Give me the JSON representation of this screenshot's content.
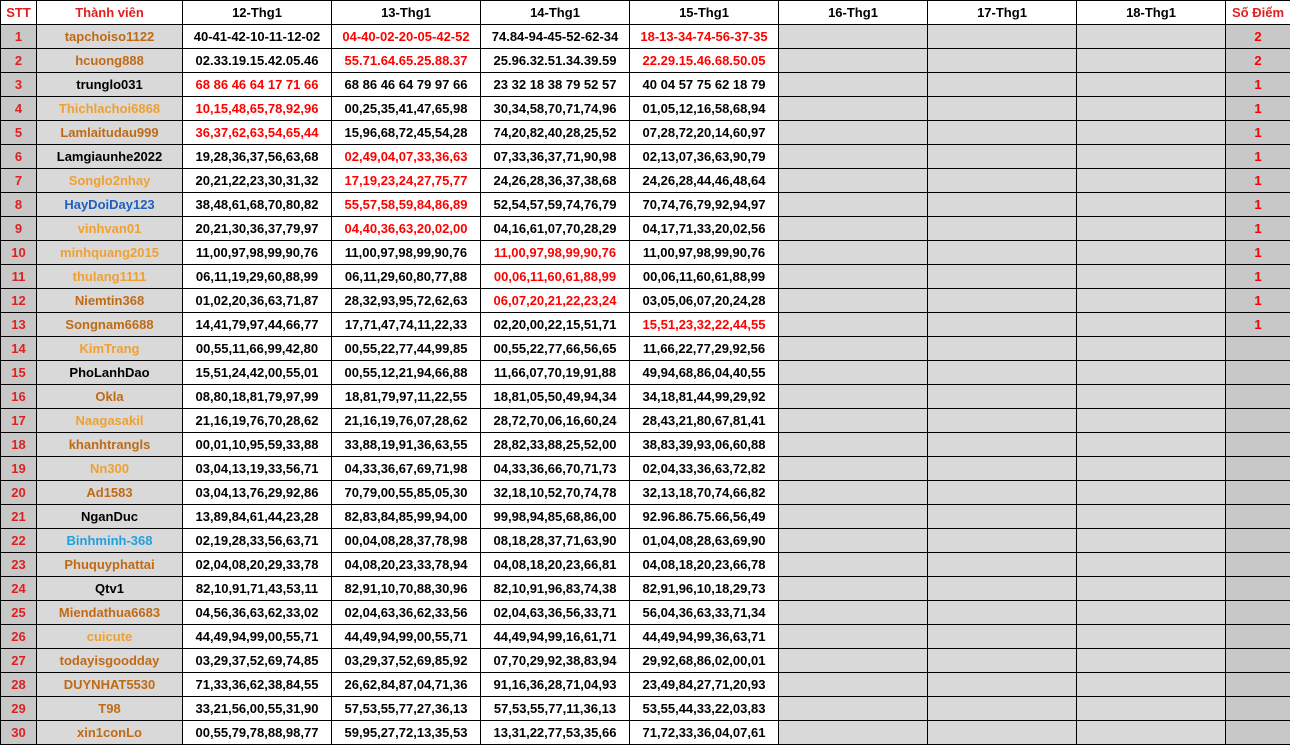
{
  "headers": {
    "stt": "STT",
    "member": "Thành viên",
    "days": [
      "12-Thg1",
      "13-Thg1",
      "14-Thg1",
      "15-Thg1",
      "16-Thg1",
      "17-Thg1",
      "18-Thg1"
    ],
    "score": "Số Điểm"
  },
  "colors": {
    "header_red": "#e02020",
    "highlight_red": "#ff0000",
    "name_orange": "#c06a14",
    "name_light_orange": "#f0a030",
    "name_blue": "#1f5fc4",
    "name_cyan": "#1fa0e0",
    "name_black": "#000000",
    "grey_fill": "#d9d9d9",
    "dark_grey_fill": "#c8c8c8"
  },
  "rows": [
    {
      "stt": "1",
      "name": "tapchoiso1122",
      "color": "#c06a14",
      "days": [
        "40-41-42-10-11-12-02",
        "04-40-02-20-05-42-52",
        "74.84-94-45-52-62-34",
        "18-13-34-74-56-37-35"
      ],
      "hl": [
        false,
        true,
        false,
        true
      ],
      "score": "2"
    },
    {
      "stt": "2",
      "name": "hcuong888",
      "color": "#c06a14",
      "days": [
        "02.33.19.15.42.05.46",
        "55.71.64.65.25.88.37",
        "25.96.32.51.34.39.59",
        "22.29.15.46.68.50.05"
      ],
      "hl": [
        false,
        true,
        false,
        true
      ],
      "score": "2"
    },
    {
      "stt": "3",
      "name": "trunglo031",
      "color": "#000000",
      "days": [
        "68 86 46 64 17 71 66",
        "68 86 46 64 79 97 66",
        "23 32 18 38 79 52 57",
        "40 04 57 75 62 18 79"
      ],
      "hl": [
        true,
        false,
        false,
        false
      ],
      "score": "1"
    },
    {
      "stt": "4",
      "name": "Thichlachoi6868",
      "color": "#f0a030",
      "days": [
        "10,15,48,65,78,92,96",
        "00,25,35,41,47,65,98",
        "30,34,58,70,71,74,96",
        "01,05,12,16,58,68,94"
      ],
      "hl": [
        true,
        false,
        false,
        false
      ],
      "score": "1"
    },
    {
      "stt": "5",
      "name": "Lamlaitudau999",
      "color": "#c06a14",
      "days": [
        "36,37,62,63,54,65,44",
        "15,96,68,72,45,54,28",
        "74,20,82,40,28,25,52",
        "07,28,72,20,14,60,97"
      ],
      "hl": [
        true,
        false,
        false,
        false
      ],
      "score": "1"
    },
    {
      "stt": "6",
      "name": "Lamgiaunhe2022",
      "color": "#000000",
      "days": [
        "19,28,36,37,56,63,68",
        "02,49,04,07,33,36,63",
        "07,33,36,37,71,90,98",
        "02,13,07,36,63,90,79"
      ],
      "hl": [
        false,
        true,
        false,
        false
      ],
      "score": "1"
    },
    {
      "stt": "7",
      "name": "Songlo2nhay",
      "color": "#f0a030",
      "days": [
        "20,21,22,23,30,31,32",
        "17,19,23,24,27,75,77",
        "24,26,28,36,37,38,68",
        "24,26,28,44,46,48,64"
      ],
      "hl": [
        false,
        true,
        false,
        false
      ],
      "score": "1"
    },
    {
      "stt": "8",
      "name": "HayDoiDay123",
      "color": "#1f5fc4",
      "days": [
        "38,48,61,68,70,80,82",
        "55,57,58,59,84,86,89",
        "52,54,57,59,74,76,79",
        "70,74,76,79,92,94,97"
      ],
      "hl": [
        false,
        true,
        false,
        false
      ],
      "score": "1"
    },
    {
      "stt": "9",
      "name": "vinhvan01",
      "color": "#f0a030",
      "days": [
        "20,21,30,36,37,79,97",
        "04,40,36,63,20,02,00",
        "04,16,61,07,70,28,29",
        "04,17,71,33,20,02,56"
      ],
      "hl": [
        false,
        true,
        false,
        false
      ],
      "score": "1"
    },
    {
      "stt": "10",
      "name": "minhquang2015",
      "color": "#f0a030",
      "days": [
        "11,00,97,98,99,90,76",
        "11,00,97,98,99,90,76",
        "11,00,97,98,99,90,76",
        "11,00,97,98,99,90,76"
      ],
      "hl": [
        false,
        false,
        true,
        false
      ],
      "score": "1"
    },
    {
      "stt": "11",
      "name": "thulang1111",
      "color": "#f0a030",
      "days": [
        "06,11,19,29,60,88,99",
        "06,11,29,60,80,77,88",
        "00,06,11,60,61,88,99",
        "00,06,11,60,61,88,99"
      ],
      "hl": [
        false,
        false,
        true,
        false
      ],
      "score": "1"
    },
    {
      "stt": "12",
      "name": "Niemtin368",
      "color": "#c06a14",
      "days": [
        "01,02,20,36,63,71,87",
        "28,32,93,95,72,62,63",
        "06,07,20,21,22,23,24",
        "03,05,06,07,20,24,28"
      ],
      "hl": [
        false,
        false,
        true,
        false
      ],
      "score": "1"
    },
    {
      "stt": "13",
      "name": "Songnam6688",
      "color": "#c06a14",
      "days": [
        "14,41,79,97,44,66,77",
        "17,71,47,74,11,22,33",
        "02,20,00,22,15,51,71",
        "15,51,23,32,22,44,55"
      ],
      "hl": [
        false,
        false,
        false,
        true
      ],
      "score": "1"
    },
    {
      "stt": "14",
      "name": "KimTrang",
      "color": "#f0a030",
      "days": [
        "00,55,11,66,99,42,80",
        "00,55,22,77,44,99,85",
        "00,55,22,77,66,56,65",
        "11,66,22,77,29,92,56"
      ],
      "hl": [
        false,
        false,
        false,
        false
      ],
      "score": ""
    },
    {
      "stt": "15",
      "name": "PhoLanhDao",
      "color": "#000000",
      "days": [
        "15,51,24,42,00,55,01",
        "00,55,12,21,94,66,88",
        "11,66,07,70,19,91,88",
        "49,94,68,86,04,40,55"
      ],
      "hl": [
        false,
        false,
        false,
        false
      ],
      "score": ""
    },
    {
      "stt": "16",
      "name": "Okla",
      "color": "#c06a14",
      "days": [
        "08,80,18,81,79,97,99",
        "18,81,79,97,11,22,55",
        "18,81,05,50,49,94,34",
        "34,18,81,44,99,29,92"
      ],
      "hl": [
        false,
        false,
        false,
        false
      ],
      "score": ""
    },
    {
      "stt": "17",
      "name": "Naagasakil",
      "color": "#f0a030",
      "days": [
        "21,16,19,76,70,28,62",
        "21,16,19,76,07,28,62",
        "28,72,70,06,16,60,24",
        "28,43,21,80,67,81,41"
      ],
      "hl": [
        false,
        false,
        false,
        false
      ],
      "score": ""
    },
    {
      "stt": "18",
      "name": "khanhtrangls",
      "color": "#c06a14",
      "days": [
        "00,01,10,95,59,33,88",
        "33,88,19,91,36,63,55",
        "28,82,33,88,25,52,00",
        "38,83,39,93,06,60,88"
      ],
      "hl": [
        false,
        false,
        false,
        false
      ],
      "score": ""
    },
    {
      "stt": "19",
      "name": "Nn300",
      "color": "#f0a030",
      "days": [
        "03,04,13,19,33,56,71",
        "04,33,36,67,69,71,98",
        "04,33,36,66,70,71,73",
        "02,04,33,36,63,72,82"
      ],
      "hl": [
        false,
        false,
        false,
        false
      ],
      "score": ""
    },
    {
      "stt": "20",
      "name": "Ad1583",
      "color": "#c06a14",
      "days": [
        "03,04,13,76,29,92,86",
        "70,79,00,55,85,05,30",
        "32,18,10,52,70,74,78",
        "32,13,18,70,74,66,82"
      ],
      "hl": [
        false,
        false,
        false,
        false
      ],
      "score": ""
    },
    {
      "stt": "21",
      "name": "NganDuc",
      "color": "#000000",
      "days": [
        "13,89,84,61,44,23,28",
        "82,83,84,85,99,94,00",
        "99,98,94,85,68,86,00",
        "92.96.86.75.66,56,49"
      ],
      "hl": [
        false,
        false,
        false,
        false
      ],
      "score": ""
    },
    {
      "stt": "22",
      "name": "Binhminh-368",
      "color": "#1fa0e0",
      "days": [
        "02,19,28,33,56,63,71",
        "00,04,08,28,37,78,98",
        "08,18,28,37,71,63,90",
        "01,04,08,28,63,69,90"
      ],
      "hl": [
        false,
        false,
        false,
        false
      ],
      "score": ""
    },
    {
      "stt": "23",
      "name": "Phuquyphattai",
      "color": "#c06a14",
      "days": [
        "02,04,08,20,29,33,78",
        "04,08,20,23,33,78,94",
        "04,08,18,20,23,66,81",
        "04,08,18,20,23,66,78"
      ],
      "hl": [
        false,
        false,
        false,
        false
      ],
      "score": ""
    },
    {
      "stt": "24",
      "name": "Qtv1",
      "color": "#000000",
      "days": [
        "82,10,91,71,43,53,11",
        "82,91,10,70,88,30,96",
        "82,10,91,96,83,74,38",
        "82,91,96,10,18,29,73"
      ],
      "hl": [
        false,
        false,
        false,
        false
      ],
      "score": ""
    },
    {
      "stt": "25",
      "name": "Miendathua6683",
      "color": "#c06a14",
      "days": [
        "04,56,36,63,62,33,02",
        "02,04,63,36,62,33,56",
        "02,04,63,36,56,33,71",
        "56,04,36,63,33,71,34"
      ],
      "hl": [
        false,
        false,
        false,
        false
      ],
      "score": ""
    },
    {
      "stt": "26",
      "name": "cuicute",
      "color": "#f0a030",
      "days": [
        "44,49,94,99,00,55,71",
        "44,49,94,99,00,55,71",
        "44,49,94,99,16,61,71",
        "44,49,94,99,36,63,71"
      ],
      "hl": [
        false,
        false,
        false,
        false
      ],
      "score": ""
    },
    {
      "stt": "27",
      "name": "todayisgoodday",
      "color": "#c06a14",
      "days": [
        "03,29,37,52,69,74,85",
        "03,29,37,52,69,85,92",
        "07,70,29,92,38,83,94",
        "29,92,68,86,02,00,01"
      ],
      "hl": [
        false,
        false,
        false,
        false
      ],
      "score": ""
    },
    {
      "stt": "28",
      "name": "DUYNHAT5530",
      "color": "#c06a14",
      "days": [
        "71,33,36,62,38,84,55",
        "26,62,84,87,04,71,36",
        "91,16,36,28,71,04,93",
        "23,49,84,27,71,20,93"
      ],
      "hl": [
        false,
        false,
        false,
        false
      ],
      "score": ""
    },
    {
      "stt": "29",
      "name": "T98",
      "color": "#c06a14",
      "days": [
        "33,21,56,00,55,31,90",
        "57,53,55,77,27,36,13",
        "57,53,55,77,11,36,13",
        "53,55,44,33,22,03,83"
      ],
      "hl": [
        false,
        false,
        false,
        false
      ],
      "score": ""
    },
    {
      "stt": "30",
      "name": "xin1conLo",
      "color": "#c06a14",
      "days": [
        "00,55,79,78,88,98,77",
        "59,95,27,72,13,35,53",
        "13,31,22,77,53,35,66",
        "71,72,33,36,04,07,61"
      ],
      "hl": [
        false,
        false,
        false,
        false
      ],
      "score": ""
    }
  ]
}
